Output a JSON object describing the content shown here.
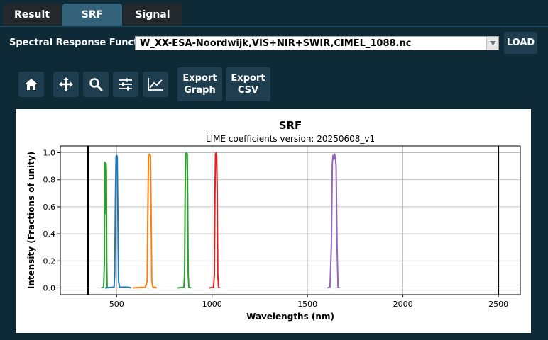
{
  "tabs": [
    {
      "label": "Result",
      "active": false
    },
    {
      "label": "SRF",
      "active": true
    },
    {
      "label": "Signal",
      "active": false
    }
  ],
  "srf": {
    "label": "Spectral Response Function:",
    "selected": "W_XX-ESA-Noordwijk,VIS+NIR+SWIR,CIMEL_1088.nc",
    "load_label": "LOAD"
  },
  "toolbar": {
    "icons": [
      "home-icon",
      "move-icon",
      "zoom-icon",
      "configure-subplots-icon",
      "edit-axis-icon"
    ],
    "export_graph": {
      "line1": "Export",
      "line2": "Graph"
    },
    "export_csv": {
      "line1": "Export",
      "line2": "CSV"
    }
  },
  "colors": {
    "background": "#0e2a36",
    "tab_active": "#34627b",
    "tab_inactive": "#22282c",
    "button": "#1e3e4f"
  },
  "chart_data": {
    "type": "line",
    "title": "SRF",
    "subtitle": "LIME coefficients version: 20250608_v1",
    "xlabel": "Wavelengths (nm)",
    "ylabel": "Intensity (Fractions of unity)",
    "xlim": [
      205,
      2615
    ],
    "ylim": [
      -0.05,
      1.05
    ],
    "xticks": [
      500,
      1000,
      1500,
      2000,
      2500
    ],
    "yticks": [
      0.0,
      0.2,
      0.4,
      0.6,
      0.8,
      1.0
    ],
    "ytick_labels": [
      "0.0",
      "0.2",
      "0.4",
      "0.6",
      "0.8",
      "1.0"
    ],
    "grid": true,
    "vlines": [
      350,
      2500
    ],
    "series": [
      {
        "color": "#2ca02c",
        "x": [
          420,
          432,
          436,
          438,
          440,
          442,
          444,
          446,
          448,
          450,
          460
        ],
        "y": [
          0,
          0.005,
          0.2,
          0.93,
          0.9,
          0.55,
          0.92,
          0.88,
          0.2,
          0.005,
          0
        ]
      },
      {
        "color": "#1f77b4",
        "x": [
          440,
          486,
          490,
          494,
          497,
          500,
          503,
          506,
          510,
          515,
          560,
          575
        ],
        "y": [
          0,
          0.005,
          0.1,
          0.7,
          0.97,
          0.98,
          0.97,
          0.6,
          0.05,
          0.005,
          0.005,
          0
        ]
      },
      {
        "color": "#ff7f0e",
        "x": [
          585,
          650,
          660,
          663,
          667,
          672,
          677,
          681,
          684,
          690,
          700,
          710
        ],
        "y": [
          0,
          0.005,
          0.05,
          0.5,
          0.97,
          0.99,
          0.98,
          0.5,
          0.05,
          0.005,
          0.005,
          0
        ]
      },
      {
        "color": "#2ca02c",
        "x": [
          820,
          852,
          856,
          859,
          862,
          866,
          870,
          872,
          875,
          878,
          890
        ],
        "y": [
          0,
          0.005,
          0.1,
          0.7,
          0.99,
          1.0,
          0.99,
          0.7,
          0.1,
          0.005,
          0
        ]
      },
      {
        "color": "#d62728",
        "x": [
          985,
          1008,
          1012,
          1015,
          1018,
          1021,
          1024,
          1027,
          1030,
          1034,
          1040
        ],
        "y": [
          0,
          0.005,
          0.1,
          0.7,
          0.99,
          1.0,
          0.98,
          0.7,
          0.1,
          0.005,
          0
        ]
      },
      {
        "color": "#9467bd",
        "x": [
          1605,
          1618,
          1625,
          1630,
          1634,
          1638,
          1642,
          1646,
          1650,
          1655,
          1660,
          1668
        ],
        "y": [
          0,
          0.005,
          0.3,
          0.92,
          0.98,
          0.95,
          0.99,
          0.96,
          0.9,
          0.3,
          0.005,
          0
        ]
      }
    ]
  }
}
